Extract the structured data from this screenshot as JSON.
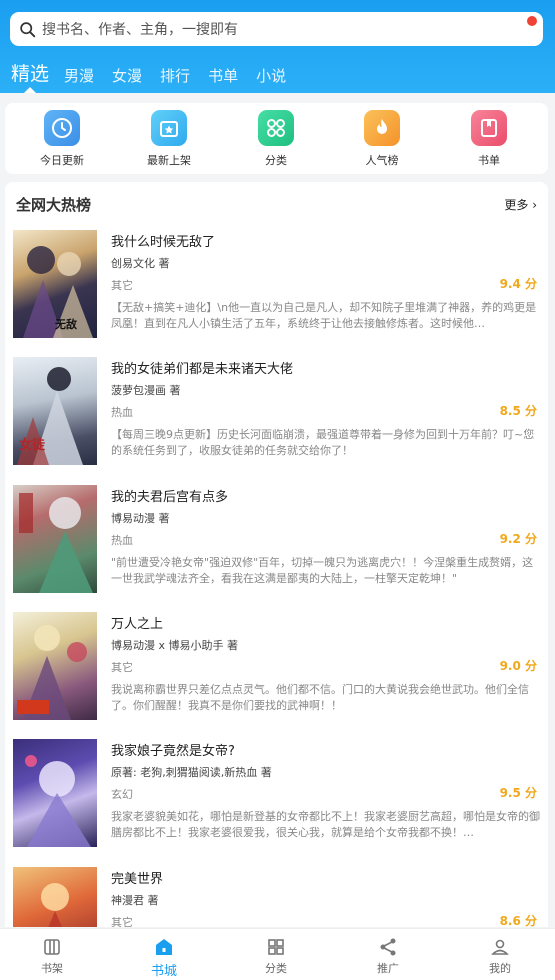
{
  "search": {
    "placeholder": "搜书名、作者、主角，一搜即有"
  },
  "nav_tabs": [
    "精选",
    "男漫",
    "女漫",
    "排行",
    "书单",
    "小说"
  ],
  "quick_entries": [
    {
      "label": "今日更新",
      "icon": "clock-icon",
      "color": "#4aa3f0"
    },
    {
      "label": "最新上架",
      "icon": "star-box-icon",
      "color": "#36b8f0"
    },
    {
      "label": "分类",
      "icon": "grid-icon",
      "color": "#2fcf93"
    },
    {
      "label": "人气榜",
      "icon": "flame-icon",
      "color": "#f8a13a"
    },
    {
      "label": "书单",
      "icon": "bookmark-book-icon",
      "color": "#f2607a"
    }
  ],
  "hot_section": {
    "title": "全网大热榜",
    "more": "更多"
  },
  "books": [
    {
      "title": "我什么时候无敌了",
      "author": "创易文化 著",
      "tag": "其它",
      "score": "9.4 分",
      "desc": "【无敌+搞笑+迪化】\\n他一直以为自己是凡人，却不知院子里堆满了神器，养的鸡更是凤凰！直到在凡人小镇生活了五年，系统终于让他去接触修炼者。这时候他…"
    },
    {
      "title": "我的女徒弟们都是未来诸天大佬",
      "author": "菠萝包漫画 著",
      "tag": "热血",
      "score": "8.5 分",
      "desc": "【每周三晚9点更新】历史长河面临崩溃，最强道尊带着一身修为回到十万年前？叮~您的系统任务到了，收服女徒弟的任务就交给你了！"
    },
    {
      "title": "我的夫君后宫有点多",
      "author": "博易动漫 著",
      "tag": "热血",
      "score": "9.2 分",
      "desc": "\"前世遭受冷艳女帝\"强迫双修\"百年，切掉一魄只为逃离虎穴！！今涅槃重生成赘婿，这一世我武学魂法齐全，看我在这满是鄙夷的大陆上，一柱擎天定乾坤！\""
    },
    {
      "title": "万人之上",
      "author": "博易动漫 x 博易小助手 著",
      "tag": "其它",
      "score": "9.0 分",
      "desc": "我说离称霸世界只差亿点点灵气。他们都不信。门口的大黄说我会绝世武功。他们全信了。你们醒醒！我真不是你们要找的武神啊！！"
    },
    {
      "title": "我家娘子竟然是女帝?",
      "author": "原著: 老狗,刺猬猫阅读,新热血 著",
      "tag": "玄幻",
      "score": "9.5 分",
      "desc": "我家老婆貌美如花，哪怕是新登基的女帝都比不上！我家老婆厨艺高超，哪怕是女帝的御膳房都比不上！我家老婆很爱我，很关心我，就算是给个女帝我都不换！…"
    },
    {
      "title": "完美世界",
      "author": "神漫君 著",
      "tag": "其它",
      "score": "8.6 分",
      "desc": ""
    }
  ],
  "bottom_tabs": [
    {
      "label": "书架",
      "icon": "bookshelf-icon"
    },
    {
      "label": "书城",
      "icon": "store-home-icon",
      "active": true
    },
    {
      "label": "分类",
      "icon": "category-grid-icon"
    },
    {
      "label": "推广",
      "icon": "share-icon"
    },
    {
      "label": "我的",
      "icon": "profile-icon"
    }
  ],
  "colors": {
    "primary": "#1a9ef0",
    "score": "#f0a81c"
  }
}
